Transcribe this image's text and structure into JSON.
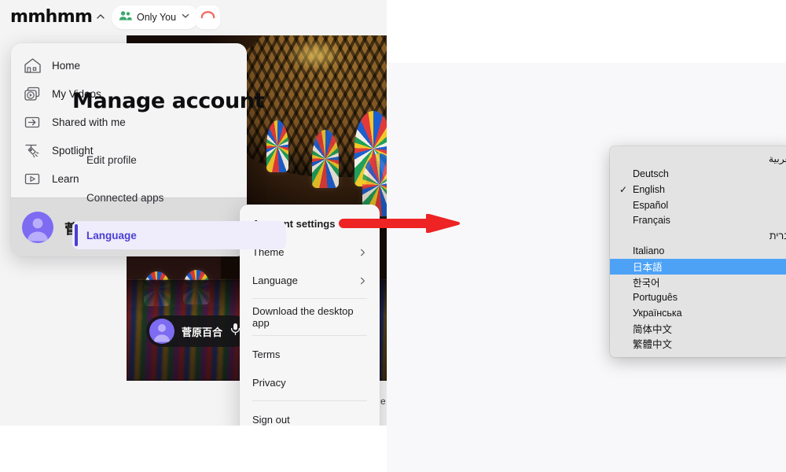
{
  "app": {
    "logo": "mmhmm",
    "presence": {
      "label": "Only You",
      "icon": "people-icon",
      "color": "#39a96a"
    },
    "hangup": {
      "icon": "hangup-icon",
      "color": "#f06a5f"
    },
    "collapse_icon": "chevron-up-icon"
  },
  "sidebar": {
    "items": [
      {
        "label": "Home",
        "icon": "home-icon"
      },
      {
        "label": "My Videos",
        "icon": "video-library-icon"
      },
      {
        "label": "Shared with me",
        "icon": "share-arrow-icon"
      },
      {
        "label": "Spotlight",
        "icon": "spotlight-icon"
      },
      {
        "label": "Learn",
        "icon": "play-box-icon"
      }
    ],
    "user": {
      "name": "菅原百合",
      "avatar": "user-avatar",
      "chevron": "chevron-right-icon"
    }
  },
  "stage": {
    "presenter_chip": {
      "name": "菅原百合",
      "mic_icon": "microphone-icon"
    },
    "background_alt": "mosque-interior-stained-glass",
    "partial_text": "e"
  },
  "context_menu": {
    "items": [
      {
        "label": "Account settings",
        "submenu": false,
        "bold": true
      },
      {
        "label": "Theme",
        "submenu": true
      },
      {
        "label": "Language",
        "submenu": true
      },
      {
        "label": "Download the desktop app",
        "submenu": false
      },
      {
        "label": "Terms",
        "submenu": false
      },
      {
        "label": "Privacy",
        "submenu": false
      },
      {
        "label": "Sign out",
        "submenu": false
      }
    ]
  },
  "manage_account": {
    "title": "Manage account",
    "items": [
      {
        "label": "Edit profile",
        "active": false
      },
      {
        "label": "Connected apps",
        "active": false
      },
      {
        "label": "Language",
        "active": true
      }
    ],
    "accent": "#4b3fd4",
    "active_background": "#efecfb"
  },
  "language_dropdown": {
    "selected_check": "English",
    "highlighted": "日本語",
    "highlight_color": "#4da2f6",
    "options": [
      "العربية",
      "Deutsch",
      "English",
      "Español",
      "Français",
      "עברית",
      "Italiano",
      "日本語",
      "한국어",
      "Português",
      "Українська",
      "简体中文",
      "繁體中文"
    ]
  },
  "annotation": {
    "arrow": "red-arrow-pointing-right",
    "color": "#ed2324"
  }
}
